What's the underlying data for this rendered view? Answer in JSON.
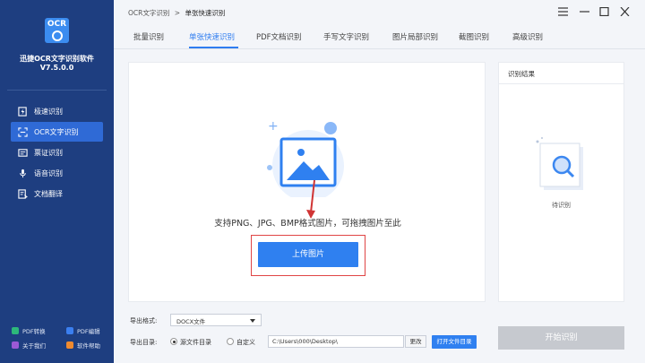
{
  "sidebar": {
    "logo_text": "OCR",
    "app_name": "迅捷OCR文字识别软件",
    "version": "V7.5.0.0",
    "items": [
      {
        "label": "极速识别",
        "icon": "lightning-doc-icon"
      },
      {
        "label": "OCR文字识别",
        "icon": "scan-frame-icon"
      },
      {
        "label": "票证识别",
        "icon": "ticket-icon"
      },
      {
        "label": "语音识别",
        "icon": "microphone-icon"
      },
      {
        "label": "文档翻译",
        "icon": "translate-doc-icon"
      }
    ],
    "active_index": 1,
    "footer": {
      "pdf_convert": "PDF转换",
      "pdf_edit": "PDF编辑",
      "about": "关于我们",
      "help": "软件帮助"
    }
  },
  "breadcrumb": {
    "root": "OCR文字识别",
    "separator": ">",
    "current": "单张快速识别"
  },
  "window_controls": [
    "menu-icon",
    "minimize-icon",
    "maximize-icon",
    "close-icon"
  ],
  "tabs": [
    "批量识别",
    "单张快速识别",
    "PDF文档识别",
    "手写文字识别",
    "图片局部识别",
    "截图识别",
    "高级识别"
  ],
  "active_tab": 1,
  "upload": {
    "hint": "支持PNG、JPG、BMP格式图片，可拖拽图片至此",
    "button": "上传图片"
  },
  "result": {
    "title": "识别结果",
    "empty_text": "待识别"
  },
  "export": {
    "format_label": "导出格式:",
    "format_value": "DOCX文件",
    "dir_label": "导出目录:",
    "radio_source": "源文件目录",
    "radio_custom": "自定义",
    "path": "C:\\Users\\000\\Desktop\\",
    "change_button": "更改",
    "open_button": "打开文件目录"
  },
  "start_button": "开始识别",
  "colors": {
    "sidebar": "#1e3e80",
    "accent": "#2f80f0",
    "highlight": "#e04545",
    "disabled": "#c6c9cf"
  }
}
